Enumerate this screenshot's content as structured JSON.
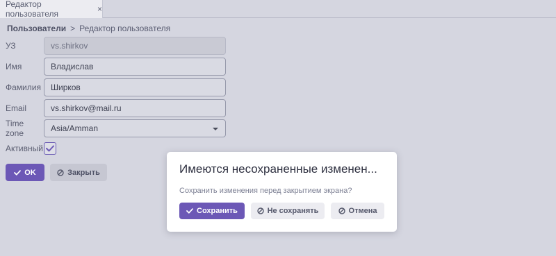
{
  "tab": {
    "label": "Редактор пользователя",
    "close": "×"
  },
  "breadcrumb": {
    "root": "Пользователи",
    "separator": ">",
    "current": "Редактор пользователя"
  },
  "form": {
    "account_label": "УЗ",
    "account_value": "vs.shirkov",
    "first_name_label": "Имя",
    "first_name_value": "Владислав",
    "last_name_label": "Фамилия",
    "last_name_value": "Ширков",
    "email_label": "Email",
    "email_value": "vs.shirkov@mail.ru",
    "timezone_label": "Time zone",
    "timezone_value": "Asia/Amman",
    "active_label": "Активный",
    "active_checked": true
  },
  "actions": {
    "ok_label": "OK",
    "close_label": "Закрыть"
  },
  "dialog": {
    "title": "Имеются несохраненные изменен...",
    "message": "Сохранить изменения перед закрытием экрана?",
    "save_label": "Сохранить",
    "dont_save_label": "Не сохранять",
    "cancel_label": "Отмена"
  },
  "colors": {
    "accent": "#6c58b6",
    "background": "#d5d6e0",
    "dialog": "#ffffff"
  },
  "icons": {
    "check": "check-icon",
    "ban": "ban-icon",
    "chevron": "chevron-down-icon"
  }
}
